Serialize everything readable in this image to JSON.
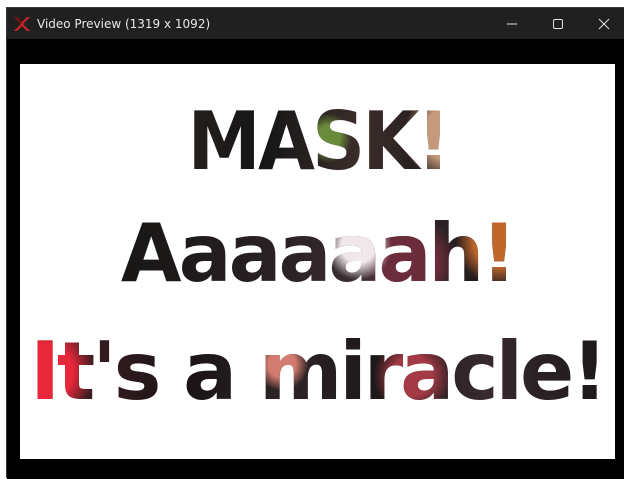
{
  "window": {
    "title": "Video Preview (1319 x 1092)",
    "icon": "app-logo-icon",
    "controls": {
      "minimize_icon": "minimize-icon",
      "maximize_icon": "maximize-icon",
      "close_icon": "close-icon"
    }
  },
  "preview": {
    "lines": [
      "MASK!",
      "Aaaaaah!",
      "It's a miracle!"
    ]
  },
  "colors": {
    "titlebar": "#202020",
    "title_text": "#e8e8e8",
    "window_bg": "#000000",
    "canvas_bg": "#ffffff",
    "logo_red": "#d2232a"
  }
}
